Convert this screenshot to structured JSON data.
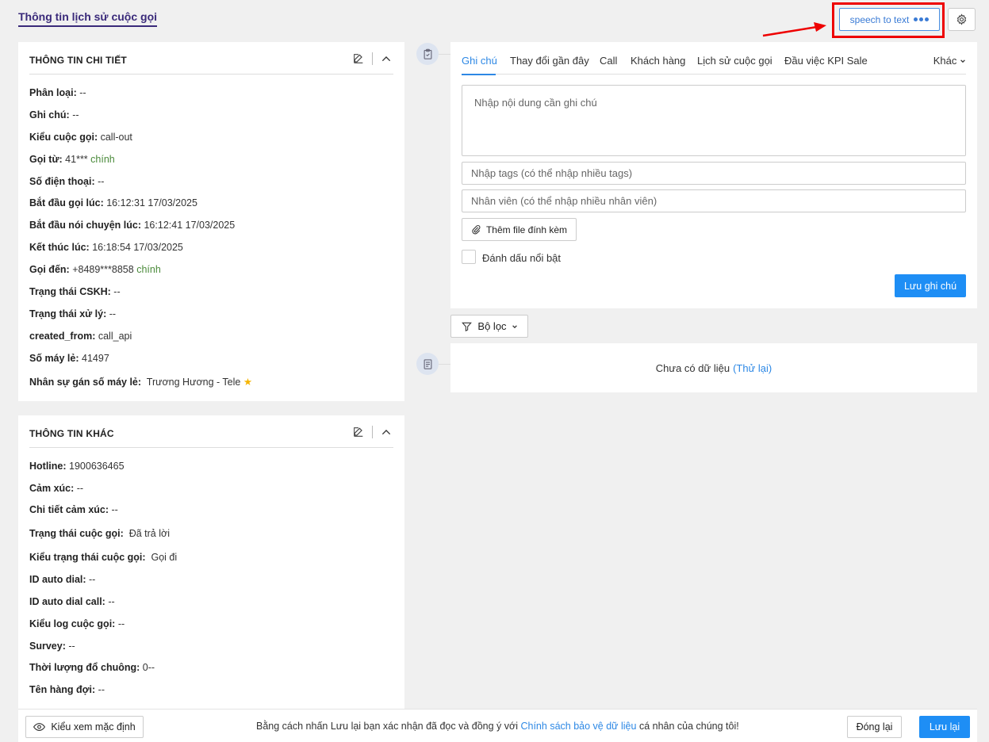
{
  "page": {
    "title": "Thông tin lịch sử cuộc gọi"
  },
  "toolbar": {
    "speech_to_text_label": "speech to text"
  },
  "detail_panel": {
    "title": "THÔNG TIN CHI TIẾT",
    "fields": [
      {
        "label": "Phân loại:",
        "value": "--"
      },
      {
        "label": "Ghi chú:",
        "value": "--"
      },
      {
        "label": "Kiểu cuộc gọi:",
        "value": "call-out"
      },
      {
        "label": "Gọi từ:",
        "value": "41***",
        "tag": "chính"
      },
      {
        "label": "Số điện thoại:",
        "value": "--"
      },
      {
        "label": "Bắt đầu gọi lúc:",
        "value": "16:12:31 17/03/2025"
      },
      {
        "label": "Bắt đầu nói chuyện lúc:",
        "value": "16:12:41 17/03/2025"
      },
      {
        "label": "Kết thúc lúc:",
        "value": "16:18:54 17/03/2025"
      },
      {
        "label": "Gọi đến:",
        "value": "+8489***8858",
        "tag": "chính"
      },
      {
        "label": "Trạng thái CSKH:",
        "value": "--"
      },
      {
        "label": "Trạng thái xử lý:",
        "value": "--"
      },
      {
        "label": "created_from:",
        "value": "call_api"
      },
      {
        "label": "Số máy lẻ:",
        "value": "41497"
      },
      {
        "label": "Nhân sự gán số máy lẻ:",
        "value": "Trương Hương - Tele"
      }
    ]
  },
  "other_panel": {
    "title": "THÔNG TIN KHÁC",
    "fields": [
      {
        "label": "Hotline:",
        "value": "1900636465"
      },
      {
        "label": "Cảm xúc:",
        "value": "--"
      },
      {
        "label": "Chi tiết cảm xúc:",
        "value": "--"
      },
      {
        "label": "Trạng thái cuộc gọi:",
        "value": "Đã trả lời"
      },
      {
        "label": "Kiểu trạng thái cuộc gọi:",
        "value": "Gọi đi"
      },
      {
        "label": "ID auto dial:",
        "value": "--"
      },
      {
        "label": "ID auto dial call:",
        "value": "--"
      },
      {
        "label": "Kiểu log cuộc gọi:",
        "value": "--"
      },
      {
        "label": "Survey:",
        "value": "--"
      },
      {
        "label": "Thời lượng đổ chuông:",
        "value": "0--"
      },
      {
        "label": "Tên hàng đợi:",
        "value": "--"
      }
    ]
  },
  "note_panel": {
    "tabs": [
      "Ghi chú",
      "Thay đổi gần đây",
      "Call",
      "Khách hàng",
      "Lịch sử cuộc gọi",
      "Đầu việc KPI Sale"
    ],
    "more_label": "Khác",
    "note_placeholder": "Nhập nội dung cần ghi chú",
    "tags_placeholder": "Nhập tags (có thể nhập nhiều tags)",
    "staff_placeholder": "Nhân viên (có thể nhập nhiều nhân viên)",
    "attach_label": "Thêm file đính kèm",
    "highlight_label": "Đánh dấu nổi bật",
    "save_note_label": "Lưu ghi chú"
  },
  "filter": {
    "label": "Bộ lọc"
  },
  "empty_state": {
    "text": "Chưa có dữ liệu",
    "retry": "(Thử lại)"
  },
  "footer": {
    "view_default_label": "Kiểu xem mặc định",
    "consent_prefix": "Bằng cách nhấn Lưu lại bạn xác nhận đã đọc và đồng ý với",
    "consent_link": "Chính sách bảo vệ dữ liệu",
    "consent_suffix": "cá nhân của chúng tôi!",
    "close_label": "Đóng lại",
    "save_label": "Lưu lại"
  },
  "colors": {
    "accent": "#1e8ef5",
    "link": "#2d88e5",
    "title": "#3a2a7a",
    "highlight": "#e00000",
    "tag": "#4a8a3a",
    "star": "#f5b400"
  },
  "icons": [
    "gear-icon",
    "edit-icon",
    "chevron-up-icon",
    "clipboard-icon",
    "document-icon",
    "paperclip-icon",
    "funnel-icon",
    "eye-icon",
    "chevron-down-icon",
    "ellipsis-icon",
    "star-icon"
  ]
}
